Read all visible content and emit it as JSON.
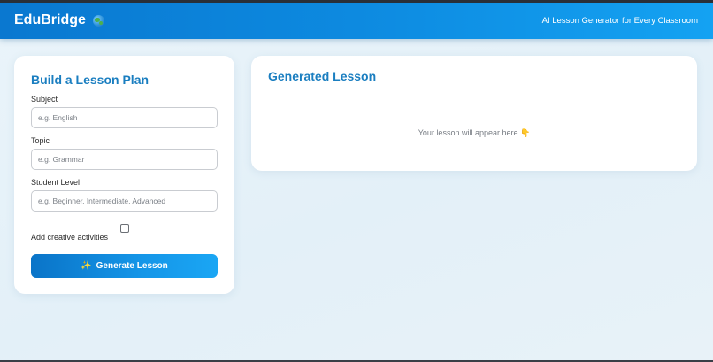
{
  "header": {
    "brand": "EduBridge",
    "brand_icon": "globe-icon",
    "tagline": "AI Lesson Generator for Every Classroom",
    "gradient_colors": [
      "#0a78d0",
      "#14a2f2"
    ]
  },
  "form": {
    "title": "Build a Lesson Plan",
    "subject": {
      "label": "Subject",
      "placeholder": "e.g. English",
      "value": ""
    },
    "topic": {
      "label": "Topic",
      "placeholder": "e.g. Grammar",
      "value": ""
    },
    "level": {
      "label": "Student Level",
      "placeholder": "e.g. Beginner, Intermediate, Advanced",
      "value": ""
    },
    "creative": {
      "label": "Add creative activities",
      "checked": false
    },
    "button": {
      "icon": "sparkles-icon",
      "icon_glyph": "✨",
      "label": "Generate Lesson"
    }
  },
  "result": {
    "title": "Generated Lesson",
    "placeholder": "Your lesson will appear here",
    "placeholder_icon": "pointing-down-hand-icon",
    "placeholder_glyph": "👇"
  },
  "colors": {
    "accent": "#1a7ec0",
    "background": "#e6f1f8"
  }
}
